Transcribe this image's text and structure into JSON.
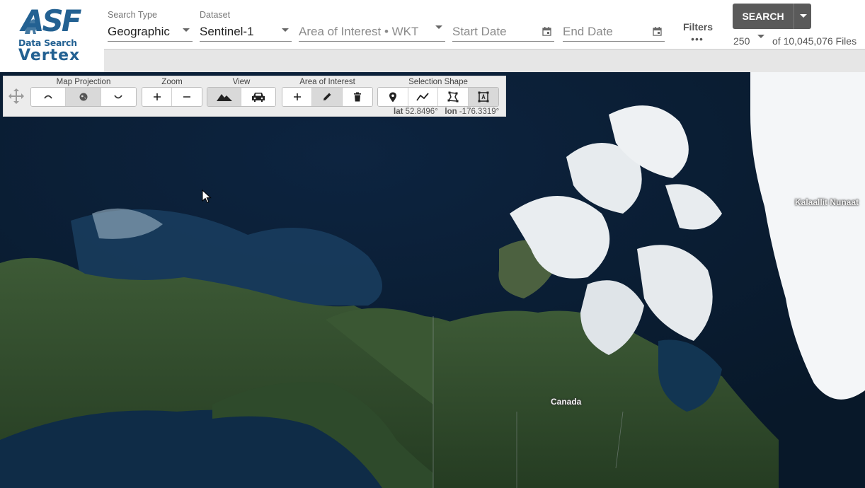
{
  "logo": {
    "asf": "ASF",
    "data_search": "Data Search",
    "vertex": "Vertex"
  },
  "header": {
    "search_type": {
      "label": "Search Type",
      "value": "Geographic"
    },
    "dataset": {
      "label": "Dataset",
      "value": "Sentinel-1"
    },
    "aoi": {
      "placeholder": "Area of Interest • WKT"
    },
    "start_date": {
      "placeholder": "Start Date"
    },
    "end_date": {
      "placeholder": "End Date"
    },
    "filters": {
      "label": "Filters",
      "dots": "•••"
    },
    "search_button": "SEARCH",
    "max_results": "250",
    "files_count": "of 10,045,076 Files"
  },
  "toolbar": {
    "map_projection": "Map Projection",
    "zoom": "Zoom",
    "view": "View",
    "area_of_interest": "Area of Interest",
    "selection_shape": "Selection Shape",
    "lat_label": "lat",
    "lat_value": "52.8496°",
    "lon_label": "lon",
    "lon_value": "-176.3319°"
  },
  "map": {
    "label_greenland": "Kalaallit Nunaat",
    "label_canada": "Canada"
  },
  "icons": {
    "move": "move-icon",
    "arctic": "arctic-projection-icon",
    "globe": "globe-icon",
    "antarctic": "antarctic-projection-icon",
    "zoom_in": "plus-icon",
    "zoom_out": "minus-icon",
    "satellite_view": "mountain-icon",
    "street_view": "car-icon",
    "aoi_add": "plus-icon",
    "aoi_draw": "pencil-icon",
    "aoi_clear": "trash-icon",
    "point": "map-pin-icon",
    "line": "line-icon",
    "polygon": "polygon-icon",
    "box": "box-icon",
    "calendar": "calendar-icon",
    "cursor": "mouse-pointer-icon"
  },
  "colors": {
    "brand": "#236192",
    "search_button": "#5a5a5a",
    "ocean": "#0b1e33",
    "land": "#2f4a2a",
    "ice": "#f0f2f4"
  }
}
